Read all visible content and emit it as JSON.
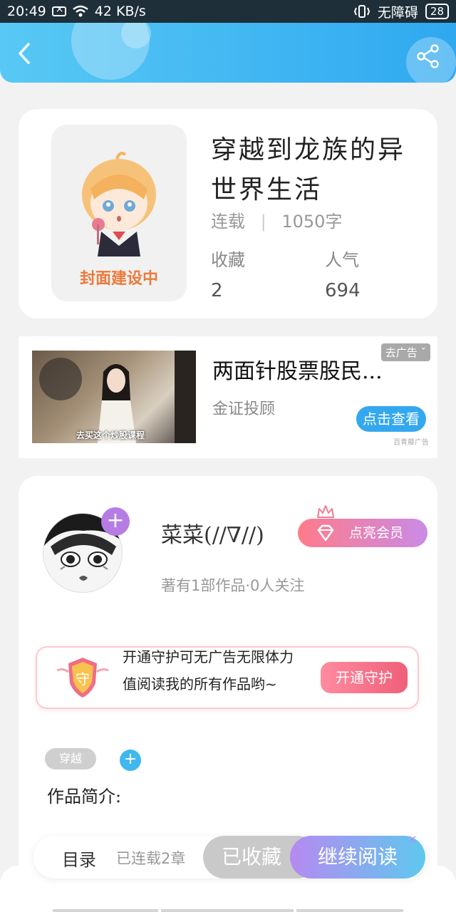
{
  "status_bar": {
    "time": "20:49",
    "network_speed": "42 KB/s",
    "accessibility_text": "无障碍",
    "battery": "28"
  },
  "book": {
    "title": "穿越到龙族的异世界生活",
    "cover_label": "封面建设中",
    "status": "连载",
    "word_count": "1050字",
    "stats": {
      "favorites_label": "收藏",
      "favorites_value": "2",
      "popularity_label": "人气",
      "popularity_value": "694"
    }
  },
  "ad": {
    "title": "两面针股票股民...",
    "source": "金证投顾",
    "close_label": "去广告",
    "cta_label": "点击查看",
    "ad_mark": "百青藤广告",
    "image_caption": "去买这个炒股课程"
  },
  "author": {
    "name": "菜菜(//∇//)",
    "vip_label": "点亮会员",
    "stats_line": "著有1部作品·0人关注",
    "guard": {
      "text": "开通守护可无广告无限体力值阅读我的所有作品哟~",
      "button_label": "开通守护",
      "shield_char": "守"
    }
  },
  "tags": [
    "穿越"
  ],
  "intro_label": "作品简介:",
  "bottom_bar": {
    "toc_label": "目录",
    "progress_label": "已连载2章",
    "collected_label": "已收藏",
    "read_label": "继续阅读"
  },
  "colors": {
    "header_start": "#58c9f5",
    "header_end": "#2fa8f0",
    "vip_start": "#ff7b8a",
    "vip_end": "#c98be6",
    "accent_blue": "#34a8ef",
    "guard_pink": "#ef5f79"
  },
  "icons": {
    "back": "back-arrow-icon",
    "share": "share-icon",
    "plus": "plus-icon",
    "crown": "crown-icon",
    "diamond": "diamond-icon",
    "shield": "shield-icon",
    "wifi": "wifi-icon",
    "mute": "vibrate-icon"
  }
}
